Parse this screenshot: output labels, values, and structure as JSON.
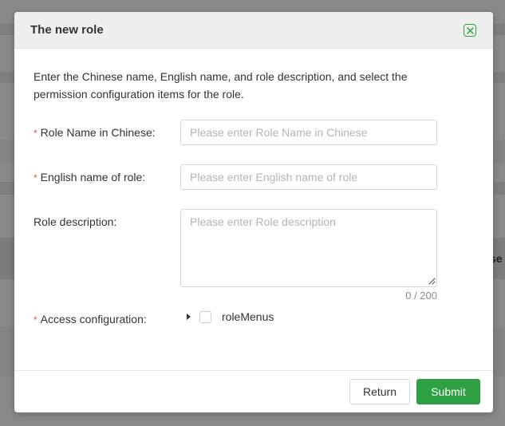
{
  "background": {
    "partial_column_text": "se"
  },
  "modal": {
    "title": "The new role",
    "close_icon": "close-icon",
    "description": "Enter the Chinese name, English name, and role description, and select the permission configuration items for the role.",
    "fields": {
      "role_name_cn": {
        "label": "Role Name in Chinese:",
        "required_mark": "*",
        "placeholder": "Please enter Role Name in Chinese",
        "value": ""
      },
      "role_name_en": {
        "label": "English name of role:",
        "required_mark": "*",
        "placeholder": "Please enter English name of role",
        "value": ""
      },
      "role_description": {
        "label": "Role description:",
        "placeholder": "Please enter Role description",
        "value": "",
        "counter": "0 / 200"
      },
      "access_config": {
        "label": "Access configuration:",
        "required_mark": "*",
        "tree_item_label": "roleMenus",
        "tree_item_checked": false,
        "tree_item_expanded": false
      }
    },
    "buttons": {
      "return_label": "Return",
      "submit_label": "Submit"
    },
    "colors": {
      "accent": "#2ea043",
      "required": "#e34d4d",
      "header_bg": "#eeeeee"
    }
  }
}
